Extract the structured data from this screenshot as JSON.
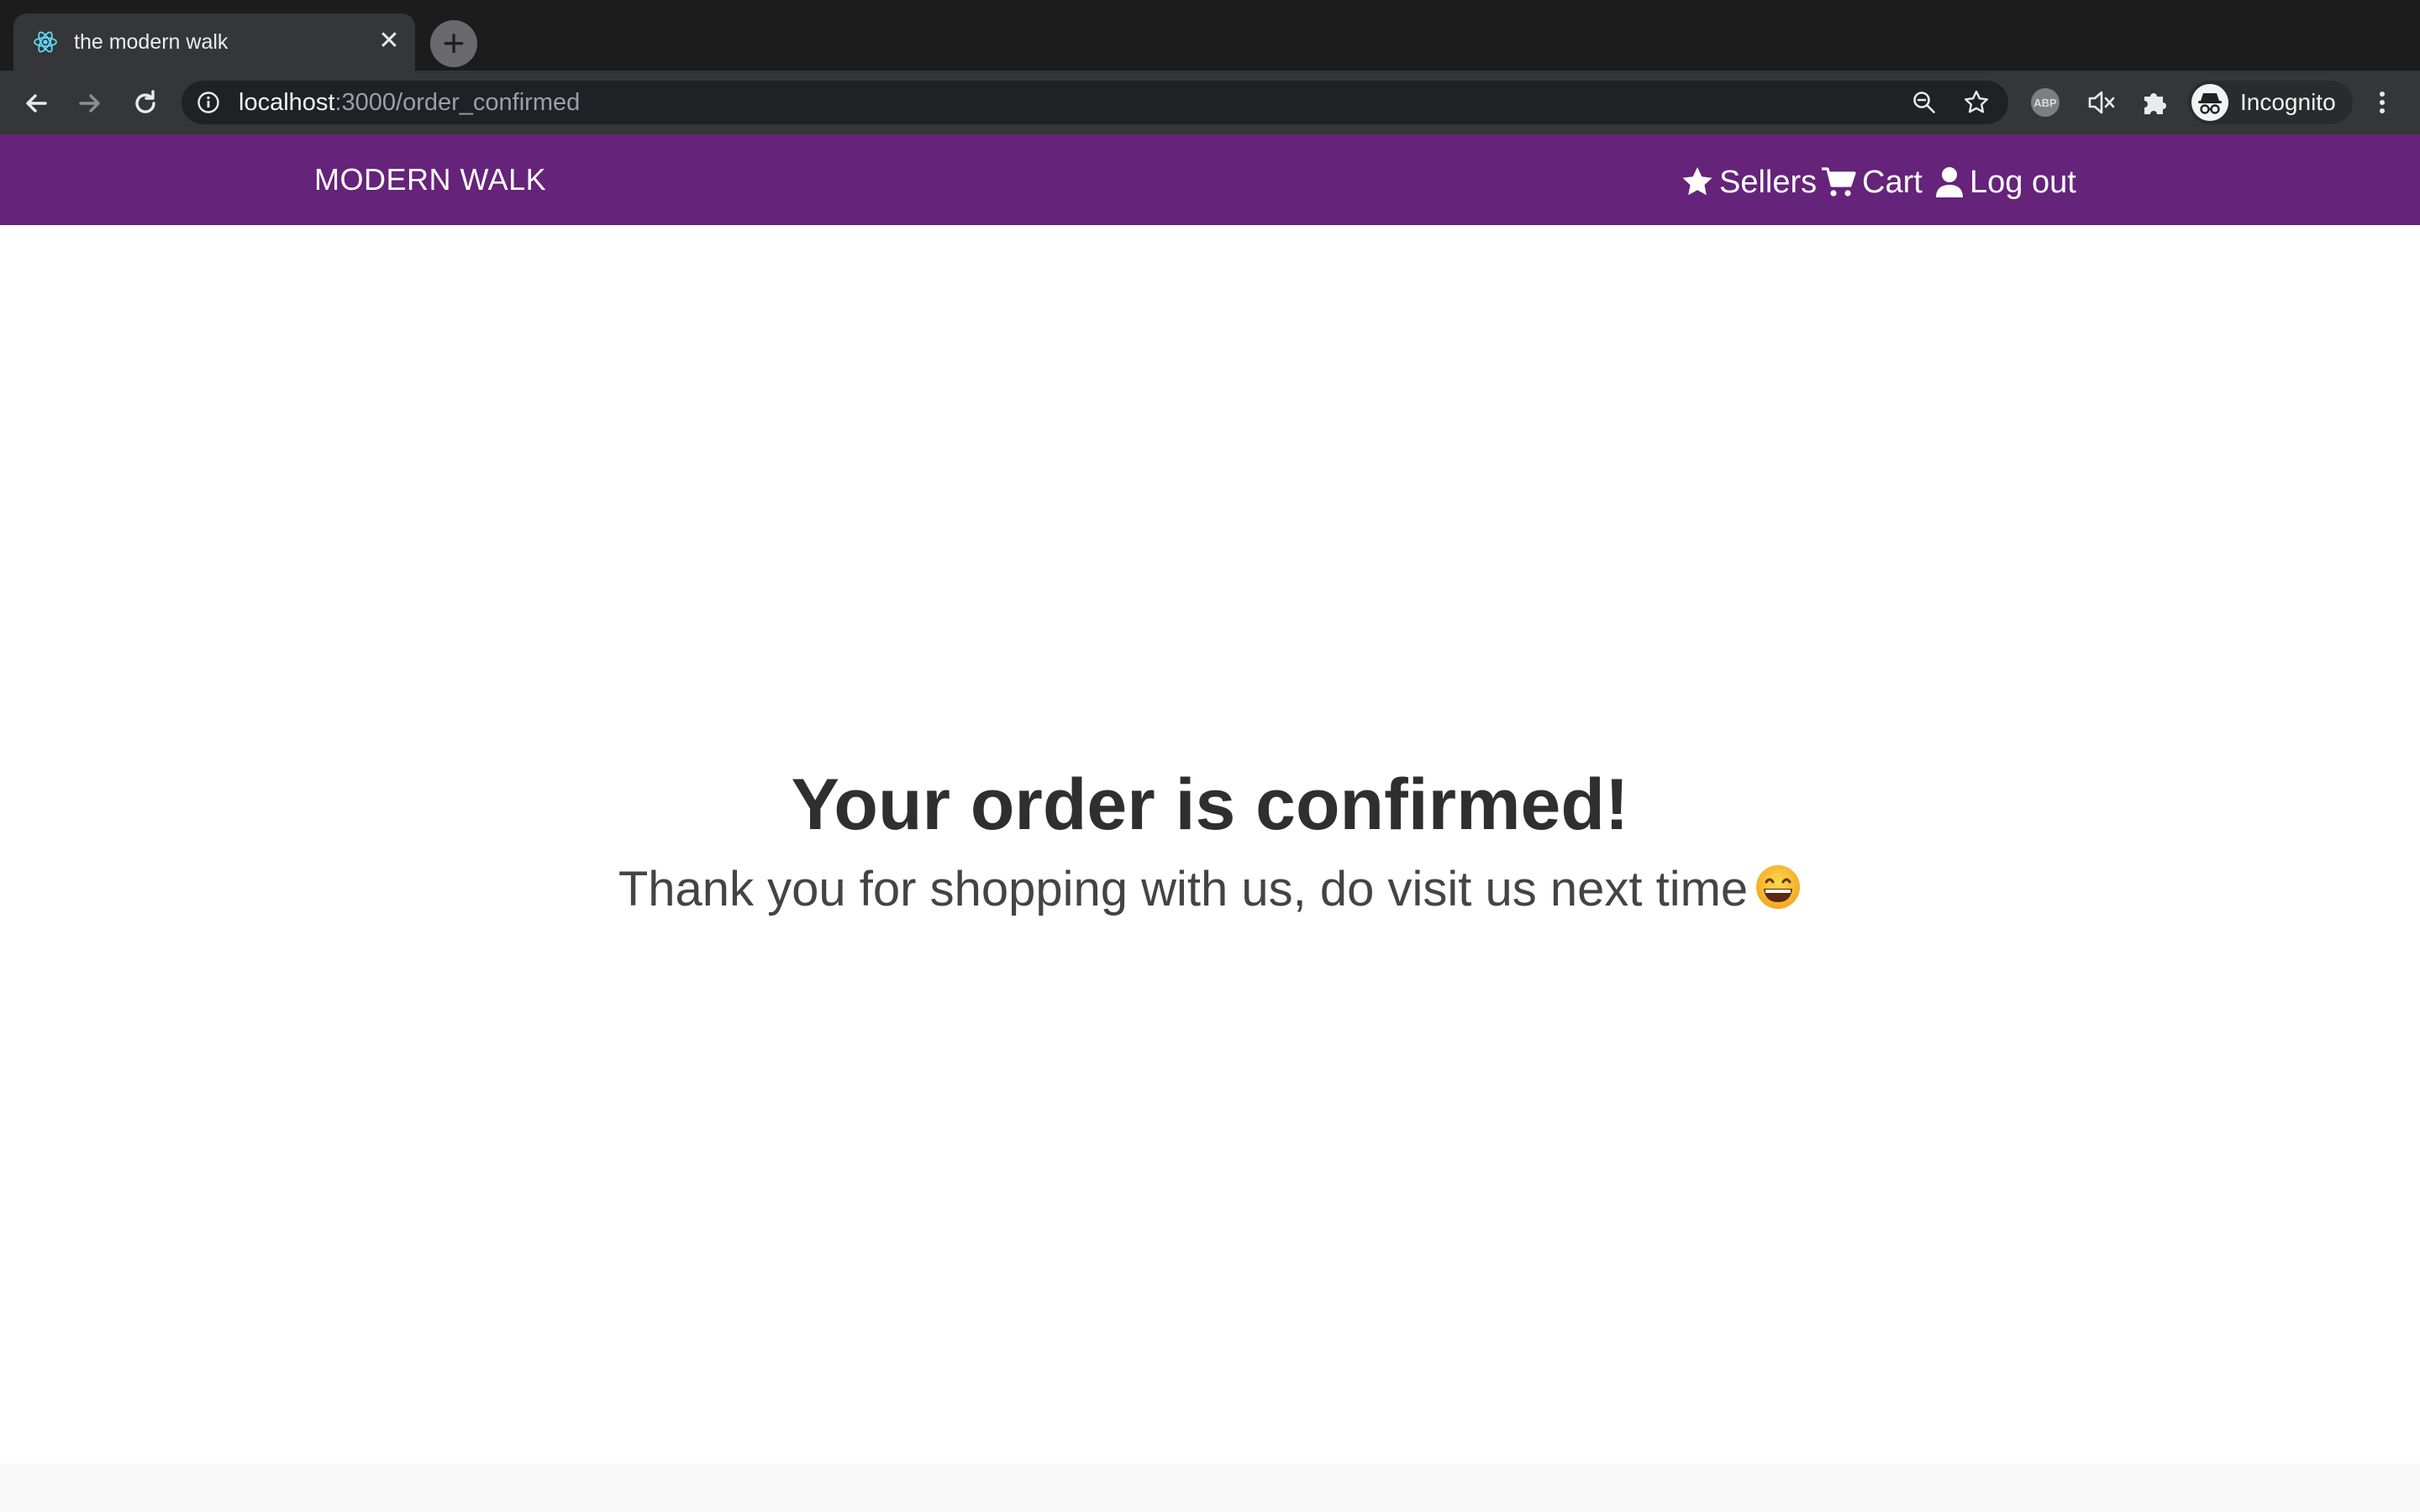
{
  "browser": {
    "tab": {
      "title": "the modern walk",
      "favicon": "react-atom-icon",
      "close": "✕"
    },
    "new_tab": "+",
    "url": {
      "host": "localhost",
      "rest": ":3000/order_confirmed"
    },
    "profile_label": "Incognito",
    "icons": [
      "back-arrow-icon",
      "forward-arrow-icon",
      "reload-icon",
      "info-icon",
      "zoom-icon",
      "star-icon",
      "adblock-icon",
      "muted-speaker-icon",
      "puzzle-icon",
      "incognito-icon",
      "kebab-menu-icon"
    ],
    "colors": {
      "tabstrip": "#1c1c1d",
      "toolbar": "#353638",
      "omnibox": "#202124"
    }
  },
  "navbar": {
    "brand": "MODERN WALK",
    "links": [
      {
        "label": "Sellers",
        "icon": "star-icon"
      },
      {
        "label": "Cart",
        "icon": "cart-icon"
      },
      {
        "label": "Log out",
        "icon": "user-icon"
      }
    ],
    "color": "#65237a"
  },
  "main": {
    "headline": "Your order is confirmed!",
    "message": "Thank you for shopping with us, do visit us next time",
    "emoji": "grinning-face-emoji"
  }
}
